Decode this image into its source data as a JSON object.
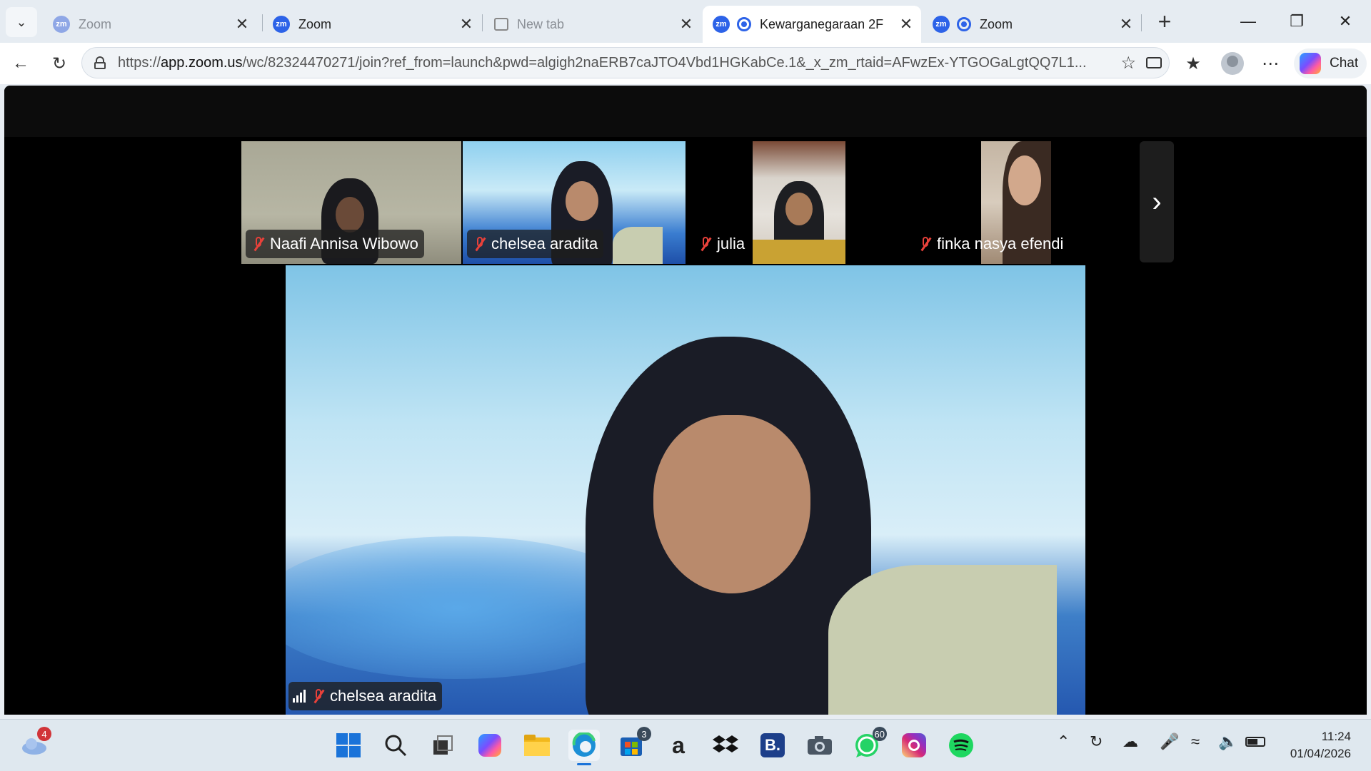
{
  "browser": {
    "tabs": [
      {
        "label": "Zoom",
        "icon": "zoom-icon",
        "active": false
      },
      {
        "label": "Zoom",
        "icon": "zoom-icon",
        "active": false
      },
      {
        "label": "New tab",
        "icon": "new-tab-page-icon",
        "active": false
      },
      {
        "label": "Kewarganegaraan 2F",
        "icon": "zoom-icon",
        "active": true,
        "recording": true
      },
      {
        "label": "Zoom",
        "icon": "zoom-icon",
        "active": false,
        "recording": true
      }
    ],
    "address_host": "app.zoom.us",
    "address_prefix": "https://",
    "address_path": "/wc/82324470271/join?ref_from=launch&pwd=algigh2naERB7caJTO4Vbd1HGKabCe.1&_x_zm_rtaid=AFwzEx-YTGOGaLgtQQ7L1...",
    "chat_label": "Chat",
    "zoom_icon_text": "zm"
  },
  "meeting": {
    "participants": [
      {
        "name": "Naafi Annisa Wibowo",
        "muted": true
      },
      {
        "name": "chelsea aradita",
        "muted": true,
        "selected": true
      },
      {
        "name": "julia",
        "muted": true
      },
      {
        "name": "finka nasya efendi",
        "muted": true
      }
    ],
    "active_speaker": {
      "name": "chelsea aradita",
      "muted": true
    }
  },
  "taskbar": {
    "weather_badge": "4",
    "store_badge": "3",
    "whatsapp_badge": "60",
    "time": "11:24",
    "date": "01/04/2026"
  },
  "colors": {
    "selected_outline": "#2fd14a",
    "muted_mic": "#e8413a",
    "zoom_blue": "#2d63e8"
  }
}
